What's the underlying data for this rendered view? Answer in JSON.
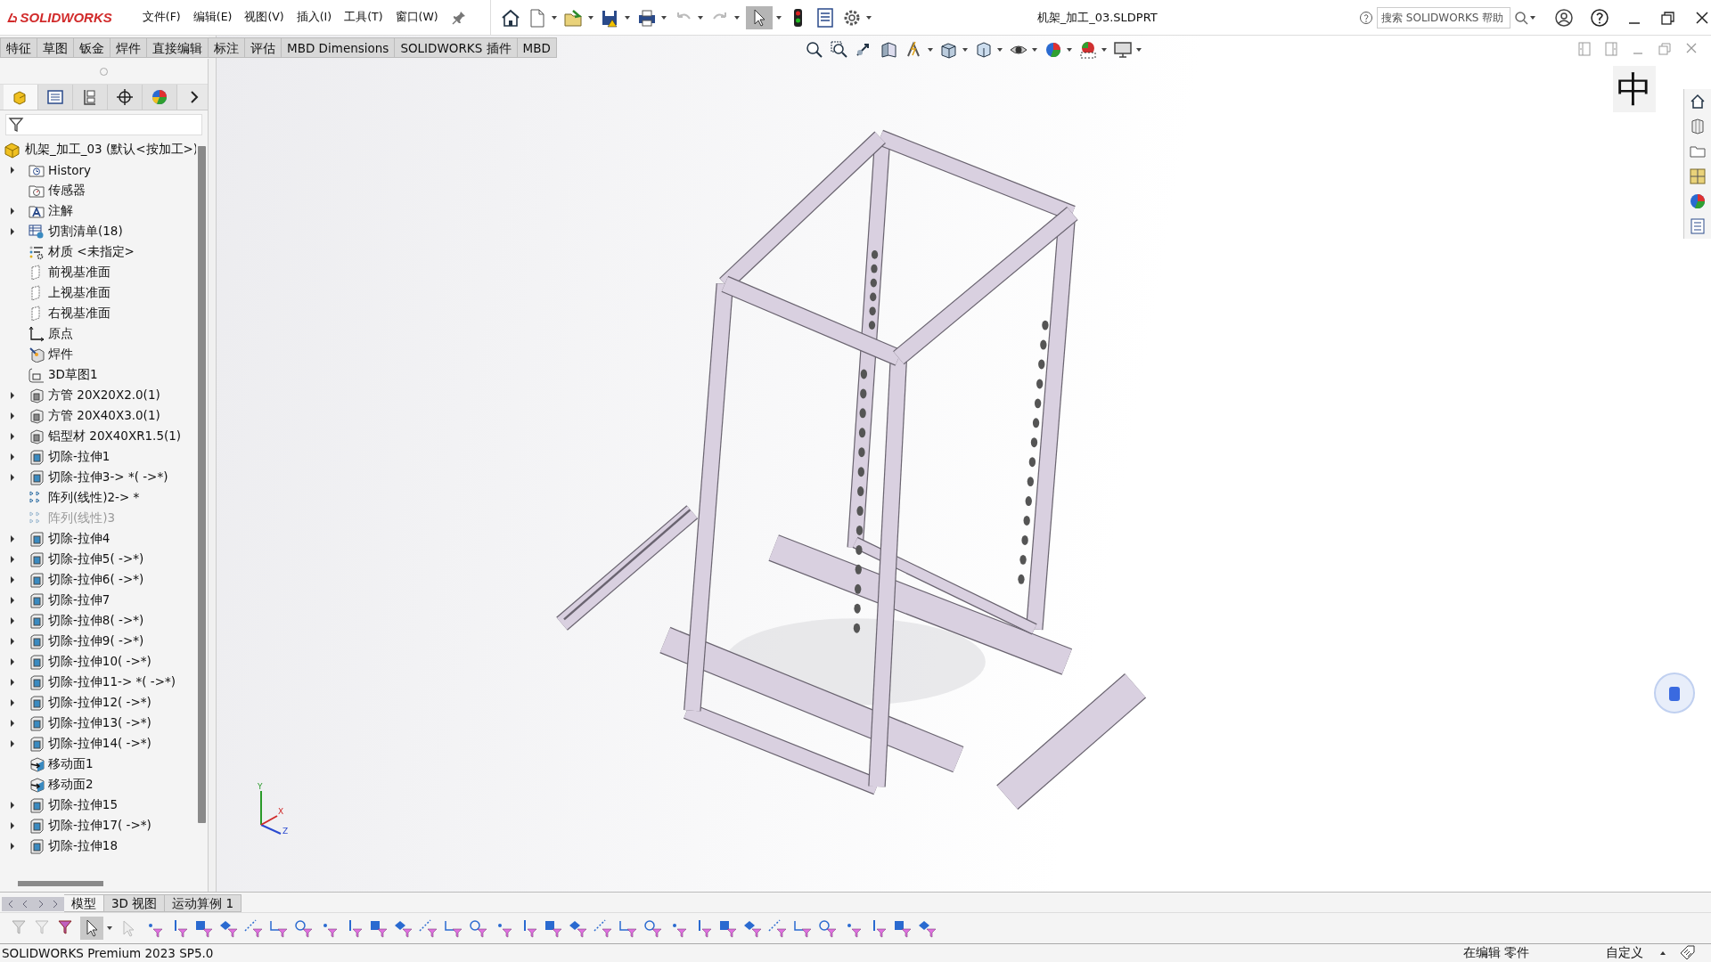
{
  "app": {
    "logo": "SOLIDWORKS"
  },
  "menu": [
    "文件(F)",
    "编辑(E)",
    "视图(V)",
    "插入(I)",
    "工具(T)",
    "窗口(W)"
  ],
  "title": "机架_加工_03.SLDPRT",
  "help_search": {
    "placeholder": "搜索 SOLIDWORKS 帮助"
  },
  "command_tabs": [
    {
      "label": "特征",
      "selected": false
    },
    {
      "label": "草图",
      "selected": false
    },
    {
      "label": "钣金",
      "selected": false
    },
    {
      "label": "焊件",
      "selected": false
    },
    {
      "label": "直接编辑",
      "selected": false
    },
    {
      "label": "标注",
      "selected": false
    },
    {
      "label": "评估",
      "selected": false
    },
    {
      "label": "MBD Dimensions",
      "selected": false
    },
    {
      "label": "SOLIDWORKS 插件",
      "selected": false
    },
    {
      "label": "MBD",
      "selected": false
    }
  ],
  "panel_tabs": [
    {
      "kind": "tree",
      "selected": true
    },
    {
      "kind": "property",
      "selected": false
    },
    {
      "kind": "config",
      "selected": false
    },
    {
      "kind": "dimxpert",
      "selected": false
    },
    {
      "kind": "display",
      "selected": false
    }
  ],
  "feature_tree": {
    "label": "机架_加工_03 (默认<按加工>)",
    "children": [
      {
        "label": "History",
        "kind": "history",
        "expandable": true,
        "suppressed": false
      },
      {
        "label": "传感器",
        "kind": "sensor",
        "expandable": false,
        "suppressed": false
      },
      {
        "label": "注解",
        "kind": "annotation",
        "expandable": true,
        "suppressed": false
      },
      {
        "label": "切割清单(18)",
        "kind": "cutlist",
        "expandable": true,
        "suppressed": false
      },
      {
        "label": "材质 <未指定>",
        "kind": "material",
        "expandable": false,
        "suppressed": false
      },
      {
        "label": "前视基准面",
        "kind": "plane",
        "expandable": false,
        "suppressed": false
      },
      {
        "label": "上视基准面",
        "kind": "plane",
        "expandable": false,
        "suppressed": false
      },
      {
        "label": "右视基准面",
        "kind": "plane",
        "expandable": false,
        "suppressed": false
      },
      {
        "label": "原点",
        "kind": "origin",
        "expandable": false,
        "suppressed": false
      },
      {
        "label": "焊件",
        "kind": "weldment",
        "expandable": false,
        "suppressed": false
      },
      {
        "label": "3D草图1",
        "kind": "sketch",
        "expandable": false,
        "suppressed": false
      },
      {
        "label": "方管 20X20X2.0(1)",
        "kind": "member",
        "expandable": true,
        "suppressed": false
      },
      {
        "label": "方管 20X40X3.0(1)",
        "kind": "member",
        "expandable": true,
        "suppressed": false
      },
      {
        "label": "铝型材 20X40XR1.5(1)",
        "kind": "member",
        "expandable": true,
        "suppressed": false
      },
      {
        "label": "切除-拉伸1",
        "kind": "cut",
        "expandable": true,
        "suppressed": false
      },
      {
        "label": "切除-拉伸3-> *( ->*)",
        "kind": "cut",
        "expandable": true,
        "suppressed": false
      },
      {
        "label": "阵列(线性)2-> *",
        "kind": "pattern",
        "expandable": false,
        "suppressed": false
      },
      {
        "label": "阵列(线性)3",
        "kind": "pattern",
        "expandable": false,
        "suppressed": true
      },
      {
        "label": "切除-拉伸4",
        "kind": "cut",
        "expandable": true,
        "suppressed": false
      },
      {
        "label": "切除-拉伸5( ->*)",
        "kind": "cut",
        "expandable": true,
        "suppressed": false
      },
      {
        "label": "切除-拉伸6( ->*)",
        "kind": "cut",
        "expandable": true,
        "suppressed": false
      },
      {
        "label": "切除-拉伸7",
        "kind": "cut",
        "expandable": true,
        "suppressed": false
      },
      {
        "label": "切除-拉伸8( ->*)",
        "kind": "cut",
        "expandable": true,
        "suppressed": false
      },
      {
        "label": "切除-拉伸9( ->*)",
        "kind": "cut",
        "expandable": true,
        "suppressed": false
      },
      {
        "label": "切除-拉伸10( ->*)",
        "kind": "cut",
        "expandable": true,
        "suppressed": false
      },
      {
        "label": "切除-拉伸11-> *( ->*)",
        "kind": "cut",
        "expandable": true,
        "suppressed": false
      },
      {
        "label": "切除-拉伸12( ->*)",
        "kind": "cut",
        "expandable": true,
        "suppressed": false
      },
      {
        "label": "切除-拉伸13( ->*)",
        "kind": "cut",
        "expandable": true,
        "suppressed": false
      },
      {
        "label": "切除-拉伸14( ->*)",
        "kind": "cut",
        "expandable": true,
        "suppressed": false
      },
      {
        "label": "移动面1",
        "kind": "move",
        "expandable": false,
        "suppressed": false
      },
      {
        "label": "移动面2",
        "kind": "move",
        "expandable": false,
        "suppressed": false
      },
      {
        "label": "切除-拉伸15",
        "kind": "cut",
        "expandable": true,
        "suppressed": false
      },
      {
        "label": "切除-拉伸17( ->*)",
        "kind": "cut",
        "expandable": true,
        "suppressed": false
      },
      {
        "label": "切除-拉伸18",
        "kind": "cut",
        "expandable": true,
        "suppressed": false
      }
    ]
  },
  "ime_indicator": "中",
  "triad": {
    "x": "X",
    "y": "Y",
    "z": "Z"
  },
  "bottom_tabs": [
    {
      "label": "模型",
      "selected": true
    },
    {
      "label": "3D 视图",
      "selected": false
    },
    {
      "label": "运动算例 1",
      "selected": false
    }
  ],
  "status_bar": {
    "version": "SOLIDWORKS Premium 2023 SP5.0",
    "mode": "在编辑 零件",
    "units": "自定义"
  }
}
